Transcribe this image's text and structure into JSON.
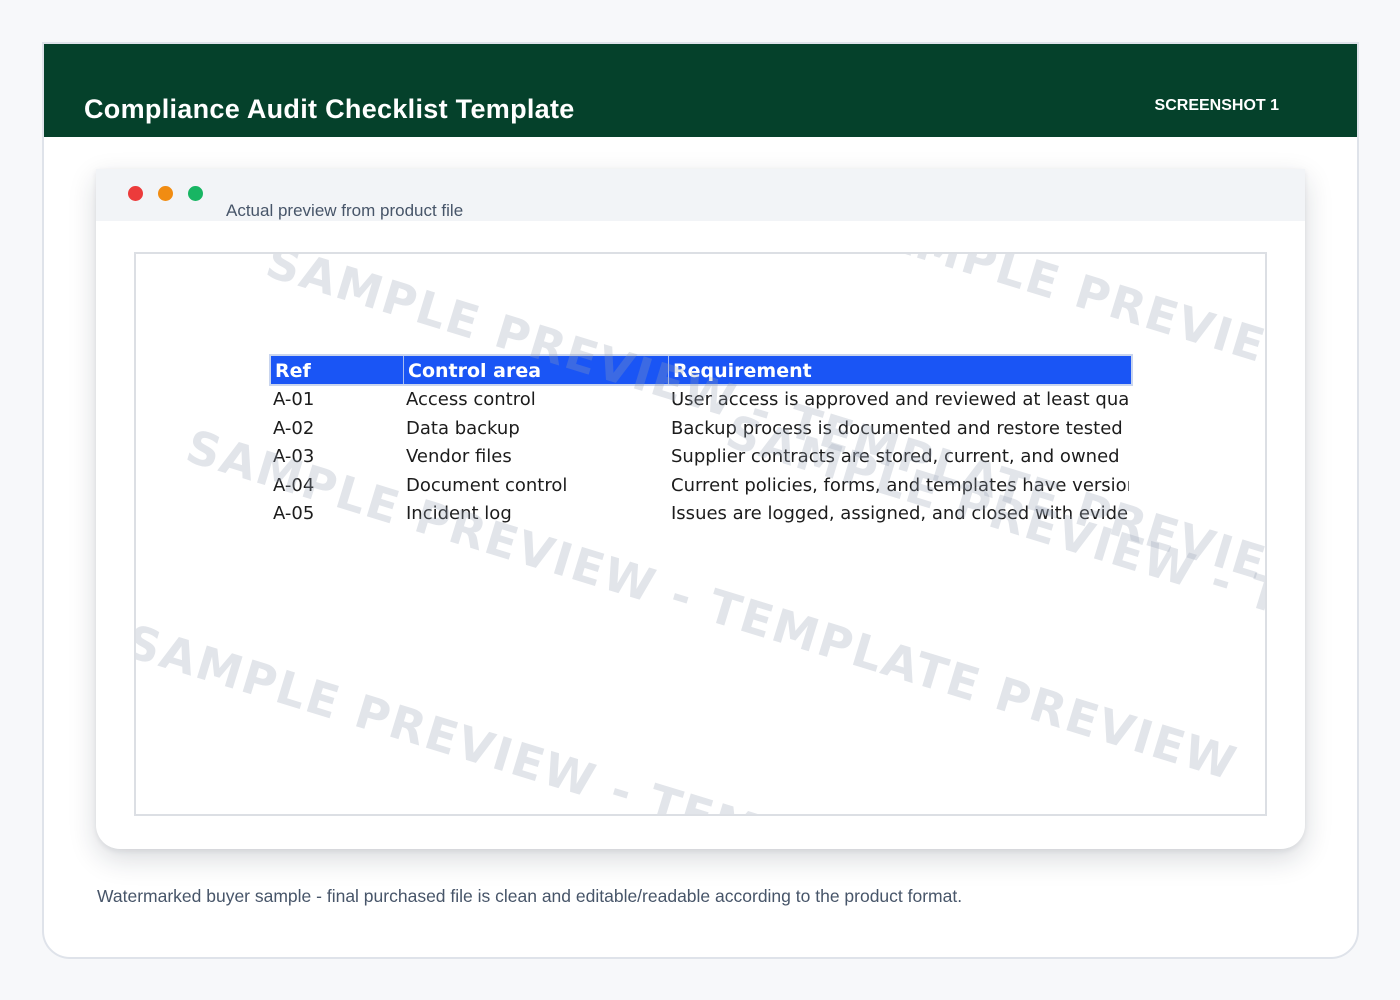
{
  "header": {
    "title": "Compliance Audit Checklist Template",
    "badge": "SCREENSHOT 1"
  },
  "window": {
    "caption": "Actual preview from product file"
  },
  "watermark": {
    "text": "SAMPLE PREVIEW - TEMPLATE PREVIEW"
  },
  "table": {
    "columns": [
      "Ref",
      "Control area",
      "Requirement"
    ],
    "rows": [
      {
        "ref": "A-01",
        "area": "Access control",
        "requirement": "User access is approved and reviewed at least quarterly"
      },
      {
        "ref": "A-02",
        "area": "Data backup",
        "requirement": "Backup process is documented and restore tested"
      },
      {
        "ref": "A-03",
        "area": "Vendor files",
        "requirement": "Supplier contracts are stored, current, and owned"
      },
      {
        "ref": "A-04",
        "area": "Document control",
        "requirement": "Current policies, forms, and templates have version control"
      },
      {
        "ref": "A-05",
        "area": "Incident log",
        "requirement": "Issues are logged, assigned, and closed with evidence"
      }
    ]
  },
  "footnote": "Watermarked buyer sample - final purchased file is clean and editable/readable according to the product format.",
  "colors": {
    "header_bg": "#05412b",
    "table_header_bg": "#1a55f5",
    "dot_red": "#ec3b3b",
    "dot_orange": "#f18c12",
    "dot_green": "#18b563"
  }
}
